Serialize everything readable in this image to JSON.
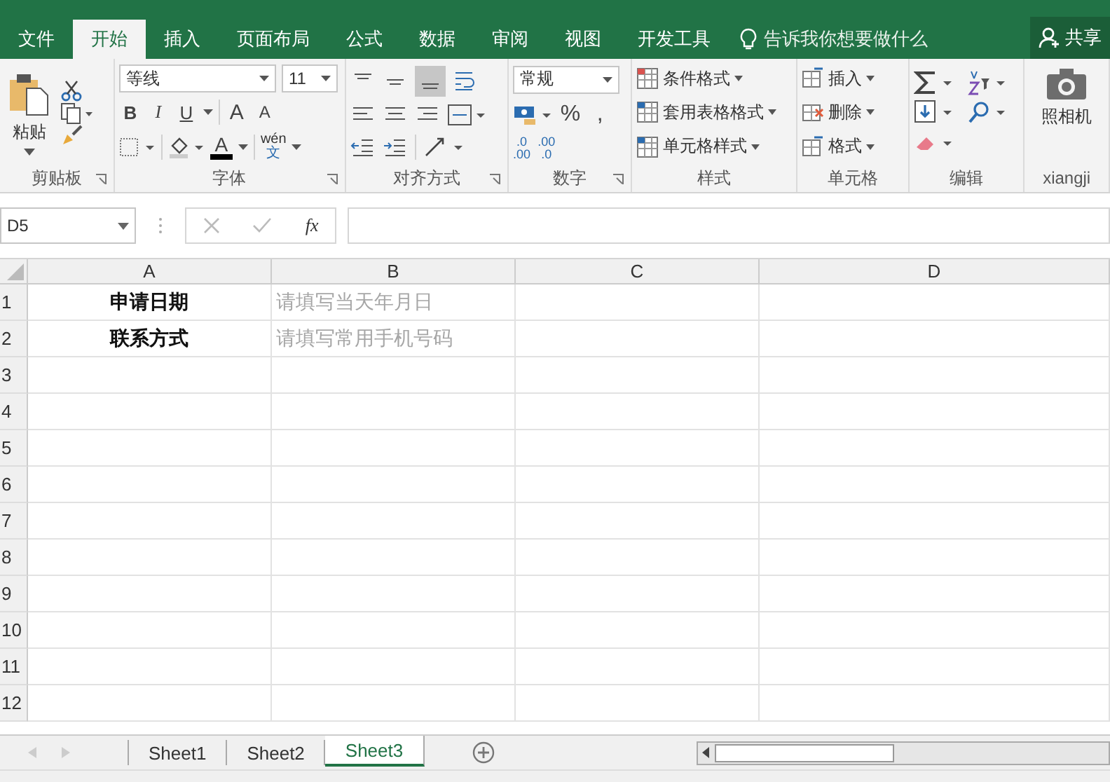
{
  "tabs": [
    {
      "label": "文件",
      "selected": false
    },
    {
      "label": "开始",
      "selected": true
    },
    {
      "label": "插入",
      "selected": false
    },
    {
      "label": "页面布局",
      "selected": false
    },
    {
      "label": "公式",
      "selected": false
    },
    {
      "label": "数据",
      "selected": false
    },
    {
      "label": "审阅",
      "selected": false
    },
    {
      "label": "视图",
      "selected": false
    },
    {
      "label": "开发工具",
      "selected": false
    }
  ],
  "tell_me": "告诉我你想要做什么",
  "share": "共享",
  "clipboard": {
    "paste": "粘贴",
    "label": "剪贴板"
  },
  "font": {
    "name": "等线",
    "size": "11",
    "bold": "B",
    "italic": "I",
    "underline": "U",
    "grow": "A",
    "shrink": "A",
    "color_letter": "A",
    "phonetic_top": "wén",
    "phonetic_bottom": "文",
    "label": "字体"
  },
  "alignment": {
    "label": "对齐方式"
  },
  "number": {
    "format": "常规",
    "percent": "%",
    "comma": ",",
    "increase_decimal": [
      ".0",
      ".00"
    ],
    "decrease_decimal": [
      ".00",
      ".0"
    ],
    "label": "数字"
  },
  "styles": {
    "items": [
      "条件格式",
      "套用表格格式",
      "单元格样式"
    ],
    "label": "样式"
  },
  "cells_group": {
    "items": [
      "插入",
      "删除",
      "格式"
    ],
    "label": "单元格"
  },
  "editing": {
    "label": "编辑"
  },
  "camera": {
    "button": "照相机",
    "label": "xiangji"
  },
  "name_box": "D5",
  "fx": "fx",
  "columns": [
    "A",
    "B",
    "C",
    "D"
  ],
  "rows": [
    {
      "number": "1",
      "cells": [
        {
          "text": "申请日期",
          "kind": "label"
        },
        {
          "text": "请填写当天年月日",
          "kind": "hint"
        }
      ]
    },
    {
      "number": "2",
      "cells": [
        {
          "text": "联系方式",
          "kind": "label"
        },
        {
          "text": "请填写常用手机号码",
          "kind": "hint"
        }
      ]
    },
    {
      "number": "3"
    },
    {
      "number": "4"
    },
    {
      "number": "5"
    },
    {
      "number": "6"
    },
    {
      "number": "7"
    },
    {
      "number": "8"
    },
    {
      "number": "9"
    },
    {
      "number": "10"
    },
    {
      "number": "11"
    },
    {
      "number": "12"
    }
  ],
  "sheets": [
    {
      "label": "Sheet1",
      "selected": false
    },
    {
      "label": "Sheet2",
      "selected": false
    },
    {
      "label": "Sheet3",
      "selected": true
    }
  ]
}
